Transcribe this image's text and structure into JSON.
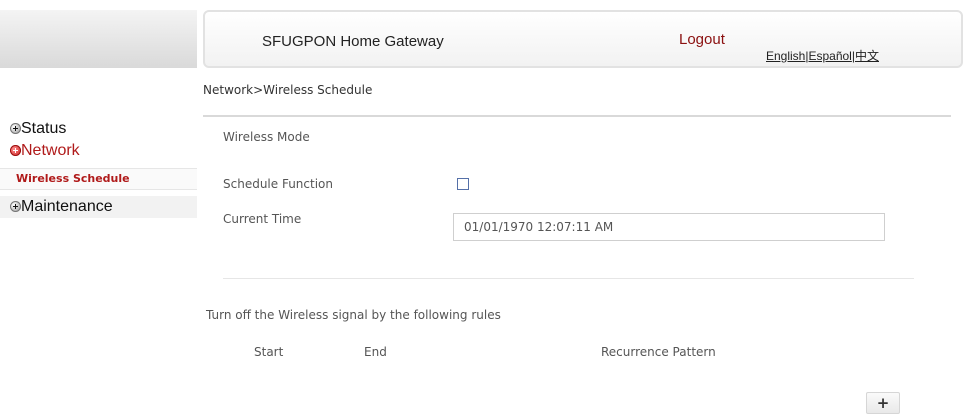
{
  "header": {
    "brand": "SFUGPON Home Gateway",
    "logout": "Logout",
    "languages": [
      "English",
      "Español",
      "中文"
    ],
    "lang_separator": "|"
  },
  "sidebar": {
    "items": [
      {
        "label": "Status",
        "active": false
      },
      {
        "label": "Network",
        "active": true
      },
      {
        "label": "Maintenance",
        "active": false
      }
    ],
    "sub_item": "Wireless Schedule"
  },
  "main": {
    "breadcrumb": "Network>Wireless Schedule",
    "section_title": "Wireless Mode",
    "schedule_function_label": "Schedule Function",
    "schedule_function_checked": false,
    "current_time_label": "Current Time",
    "current_time_value": "01/01/1970 12:07:11 AM",
    "rules_title": "Turn off the Wireless signal by the following rules",
    "columns": [
      "Start",
      "End",
      "Recurrence Pattern"
    ],
    "add_button": "+"
  },
  "colors": {
    "accent": "#b01a1a",
    "logout": "#8b1010",
    "checkbox_border": "#5570a8"
  }
}
